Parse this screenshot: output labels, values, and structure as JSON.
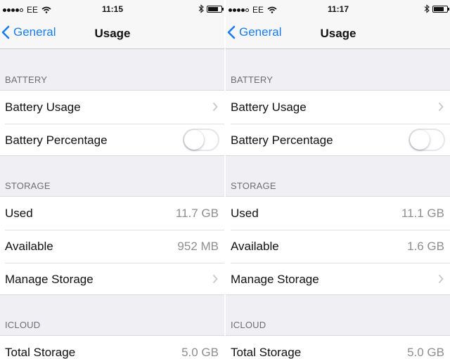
{
  "screens": [
    {
      "status": {
        "carrier": "EE",
        "time": "11:15"
      },
      "nav": {
        "back_label": "General",
        "title": "Usage"
      },
      "battery_section": {
        "header": "BATTERY",
        "usage_label": "Battery Usage",
        "percentage_label": "Battery Percentage",
        "percentage_on": false
      },
      "storage_section": {
        "header": "STORAGE",
        "used_label": "Used",
        "used_value": "11.7 GB",
        "available_label": "Available",
        "available_value": "952 MB",
        "manage_label": "Manage Storage"
      },
      "icloud_section": {
        "header": "ICLOUD",
        "total_label": "Total Storage",
        "total_value": "5.0 GB"
      }
    },
    {
      "status": {
        "carrier": "EE",
        "time": "11:17"
      },
      "nav": {
        "back_label": "General",
        "title": "Usage"
      },
      "battery_section": {
        "header": "BATTERY",
        "usage_label": "Battery Usage",
        "percentage_label": "Battery Percentage",
        "percentage_on": false
      },
      "storage_section": {
        "header": "STORAGE",
        "used_label": "Used",
        "used_value": "11.1 GB",
        "available_label": "Available",
        "available_value": "1.6 GB",
        "manage_label": "Manage Storage"
      },
      "icloud_section": {
        "header": "ICLOUD",
        "total_label": "Total Storage",
        "total_value": "5.0 GB"
      }
    }
  ],
  "colors": {
    "accent": "#1a7cf0",
    "background": "#efeff4",
    "secondary_text": "#8e8e93",
    "header_text": "#6d6d72"
  }
}
